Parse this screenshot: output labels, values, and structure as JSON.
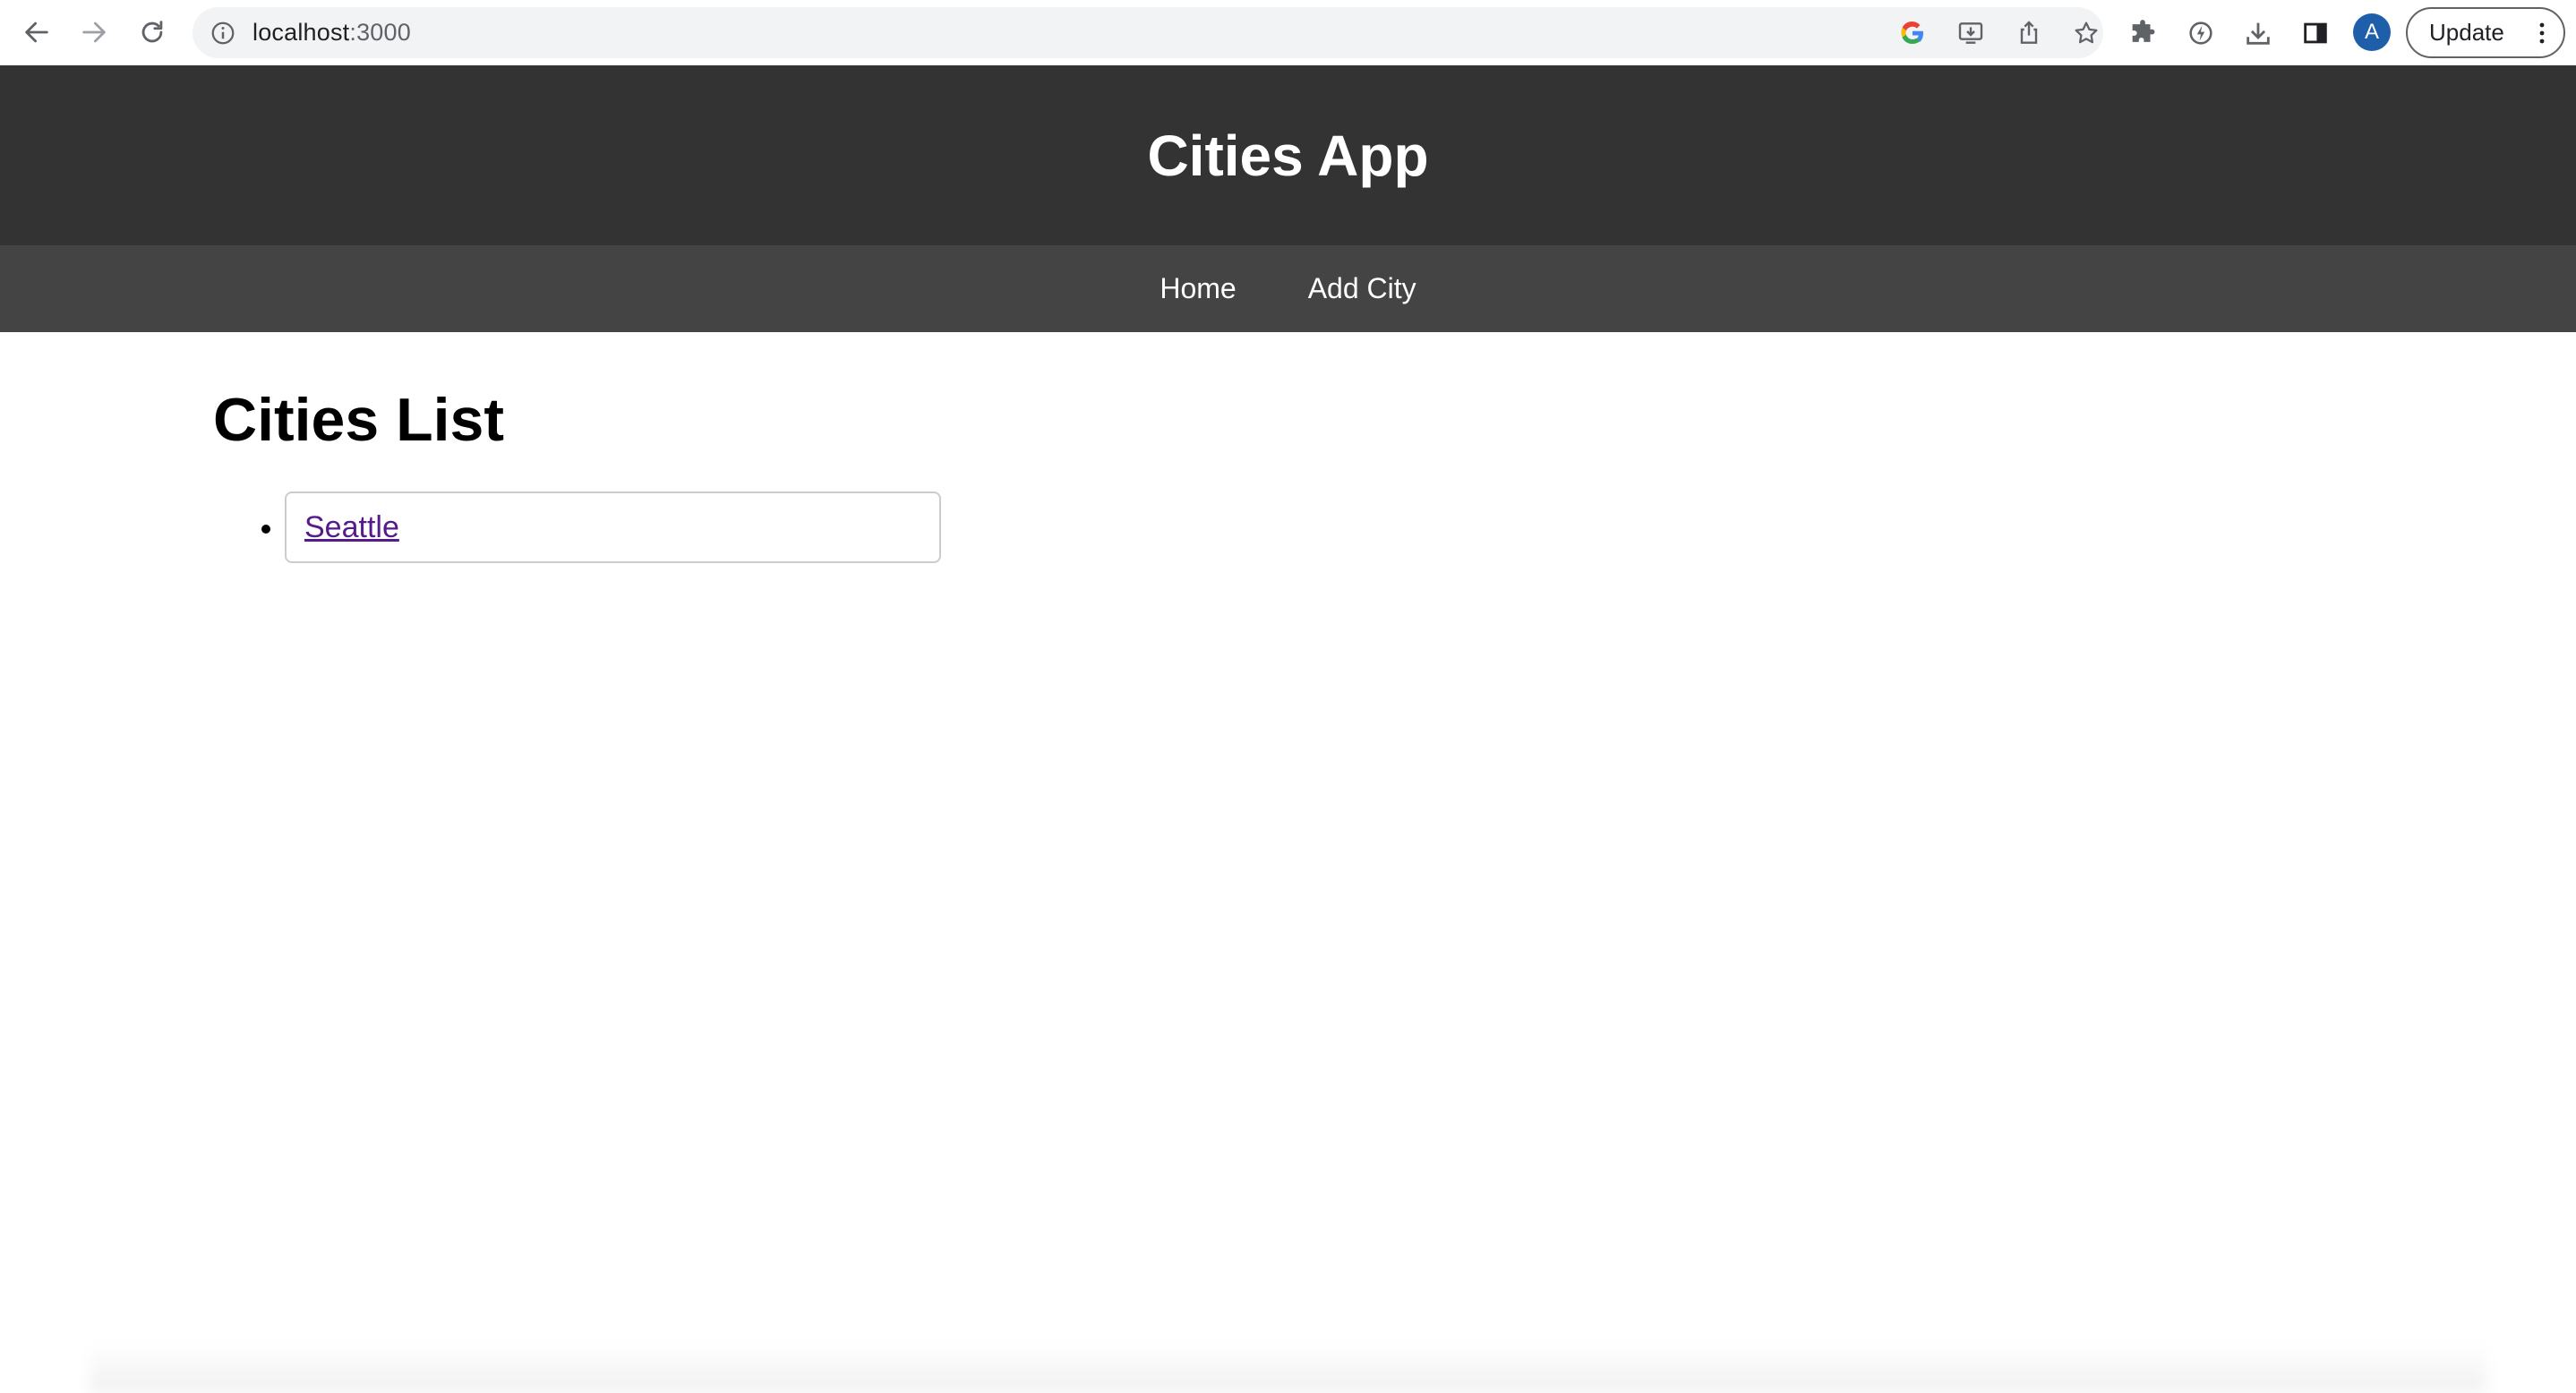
{
  "browser": {
    "url_host": "localhost",
    "url_port": ":3000",
    "avatar_letter": "A",
    "update_label": "Update",
    "icons": {
      "back": "back-arrow-icon",
      "forward": "forward-arrow-icon",
      "reload": "reload-icon",
      "site_info": "info-icon",
      "google": "google-icon",
      "install": "install-app-icon",
      "share": "share-icon",
      "bookmark": "star-icon",
      "extensions": "puzzle-icon",
      "performance": "performance-icon",
      "downloads": "download-icon",
      "side_panel": "side-panel-icon",
      "menu": "kebab-menu-icon"
    }
  },
  "app": {
    "title": "Cities App",
    "nav": {
      "home": "Home",
      "add_city": "Add City"
    }
  },
  "main": {
    "heading": "Cities List",
    "cities": [
      {
        "name": "Seattle"
      }
    ]
  },
  "colors": {
    "header_bg": "#333333",
    "nav_bg": "#444444",
    "visited_link": "#551a8b",
    "avatar_bg": "#1f5fa9"
  }
}
